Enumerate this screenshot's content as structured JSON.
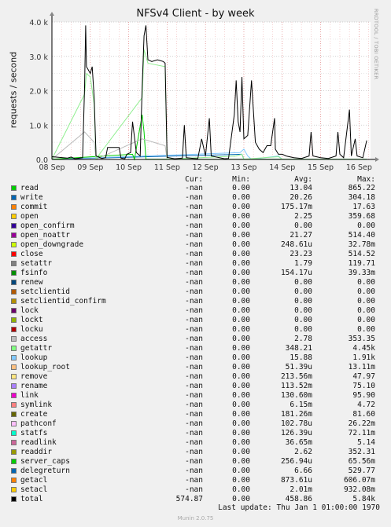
{
  "chart_data": {
    "type": "line",
    "title": "NFSv4 Client - by week",
    "ylabel": "requests / second",
    "xlabel": "",
    "ylim": [
      0,
      4000
    ],
    "y_ticks": [
      "0.0",
      "1.0 k",
      "2.0 k",
      "3.0 k",
      "4.0 k"
    ],
    "x_ticks": [
      "08 Sep",
      "09 Sep",
      "10 Sep",
      "11 Sep",
      "12 Sep",
      "13 Sep",
      "14 Sep",
      "15 Sep",
      "16 Sep"
    ],
    "x_range_days": [
      0,
      8.3
    ],
    "grid": true,
    "series": [
      {
        "name": "total",
        "color": "#000000",
        "points": [
          [
            0,
            80
          ],
          [
            0.2,
            60
          ],
          [
            0.4,
            40
          ],
          [
            0.5,
            70
          ],
          [
            0.6,
            20
          ],
          [
            0.8,
            50
          ],
          [
            0.85,
            2100
          ],
          [
            0.88,
            3900
          ],
          [
            0.9,
            2700
          ],
          [
            0.95,
            2600
          ],
          [
            1.0,
            2500
          ],
          [
            1.05,
            2700
          ],
          [
            1.1,
            1800
          ],
          [
            1.15,
            100
          ],
          [
            1.3,
            30
          ],
          [
            1.4,
            50
          ],
          [
            1.45,
            350
          ],
          [
            1.75,
            350
          ],
          [
            1.8,
            40
          ],
          [
            1.9,
            20
          ],
          [
            1.95,
            150
          ],
          [
            2.05,
            200
          ],
          [
            2.1,
            1100
          ],
          [
            2.2,
            200
          ],
          [
            2.3,
            100
          ],
          [
            2.35,
            2100
          ],
          [
            2.4,
            3600
          ],
          [
            2.45,
            3900
          ],
          [
            2.5,
            2900
          ],
          [
            2.6,
            2850
          ],
          [
            2.75,
            2900
          ],
          [
            2.9,
            2850
          ],
          [
            2.95,
            2800
          ],
          [
            3.0,
            60
          ],
          [
            3.2,
            20
          ],
          [
            3.4,
            40
          ],
          [
            3.45,
            1000
          ],
          [
            3.5,
            50
          ],
          [
            3.7,
            30
          ],
          [
            3.8,
            20
          ],
          [
            3.9,
            600
          ],
          [
            4.0,
            100
          ],
          [
            4.1,
            1200
          ],
          [
            4.15,
            100
          ],
          [
            4.5,
            20
          ],
          [
            4.6,
            30
          ],
          [
            4.75,
            1300
          ],
          [
            4.8,
            2300
          ],
          [
            4.85,
            1100
          ],
          [
            4.9,
            800
          ],
          [
            4.95,
            2400
          ],
          [
            5.0,
            600
          ],
          [
            5.1,
            700
          ],
          [
            5.2,
            2300
          ],
          [
            5.3,
            500
          ],
          [
            5.4,
            300
          ],
          [
            5.5,
            200
          ],
          [
            5.6,
            400
          ],
          [
            5.7,
            400
          ],
          [
            5.8,
            1200
          ],
          [
            5.82,
            300
          ],
          [
            5.9,
            150
          ],
          [
            6.0,
            150
          ],
          [
            6.1,
            100
          ],
          [
            6.3,
            50
          ],
          [
            6.5,
            30
          ],
          [
            6.7,
            100
          ],
          [
            6.75,
            800
          ],
          [
            6.8,
            100
          ],
          [
            7.0,
            50
          ],
          [
            7.2,
            30
          ],
          [
            7.4,
            100
          ],
          [
            7.45,
            800
          ],
          [
            7.5,
            150
          ],
          [
            7.6,
            50
          ],
          [
            7.75,
            1450
          ],
          [
            7.8,
            100
          ],
          [
            7.9,
            600
          ],
          [
            7.95,
            100
          ],
          [
            8.1,
            50
          ],
          [
            8.2,
            550
          ]
        ]
      },
      {
        "name": "getattr",
        "color": "#90ee90",
        "points": [
          [
            0,
            10
          ],
          [
            0.85,
            1900
          ],
          [
            0.9,
            2500
          ],
          [
            1.0,
            2400
          ],
          [
            1.1,
            1600
          ],
          [
            1.15,
            20
          ],
          [
            2.35,
            1800
          ],
          [
            2.4,
            3200
          ],
          [
            2.5,
            2800
          ],
          [
            2.95,
            2700
          ],
          [
            3.0,
            10
          ],
          [
            4.8,
            100
          ],
          [
            4.95,
            150
          ],
          [
            5.0,
            10
          ],
          [
            5.9,
            80
          ],
          [
            6.0,
            10
          ],
          [
            8.2,
            10
          ]
        ]
      },
      {
        "name": "access",
        "color": "#bbbbbb",
        "points": [
          [
            0,
            5
          ],
          [
            0.85,
            800
          ],
          [
            1.1,
            500
          ],
          [
            1.15,
            5
          ],
          [
            2.35,
            600
          ],
          [
            2.95,
            400
          ],
          [
            3.0,
            5
          ],
          [
            8.2,
            5
          ]
        ]
      },
      {
        "name": "read",
        "color": "#00cc00",
        "points": [
          [
            0,
            5
          ],
          [
            2.1,
            150
          ],
          [
            2.15,
            5
          ],
          [
            2.35,
            1300
          ],
          [
            2.4,
            800
          ],
          [
            2.45,
            5
          ],
          [
            8.2,
            5
          ]
        ]
      },
      {
        "name": "lookup",
        "color": "#80c8ff",
        "points": [
          [
            0,
            5
          ],
          [
            4.9,
            200
          ],
          [
            5.0,
            300
          ],
          [
            5.1,
            100
          ],
          [
            5.2,
            5
          ],
          [
            5.9,
            100
          ],
          [
            6.0,
            5
          ],
          [
            8.2,
            5
          ]
        ]
      },
      {
        "name": "write",
        "color": "#0066b3",
        "points": [
          [
            0,
            5
          ],
          [
            4.95,
            150
          ],
          [
            5.0,
            5
          ],
          [
            8.2,
            5
          ]
        ]
      }
    ]
  },
  "legend": {
    "headers": {
      "cur": "Cur:",
      "min": "Min:",
      "avg": "Avg:",
      "max": "Max:"
    },
    "rows": [
      {
        "name": "read",
        "color": "#00cc00",
        "cur": "-nan",
        "min": "0.00",
        "avg": "13.04",
        "max": "865.22"
      },
      {
        "name": "write",
        "color": "#0066b3",
        "cur": "-nan",
        "min": "0.00",
        "avg": "20.26",
        "max": "304.18"
      },
      {
        "name": "commit",
        "color": "#ff8000",
        "cur": "-nan",
        "min": "0.00",
        "avg": "175.17m",
        "max": "17.63"
      },
      {
        "name": "open",
        "color": "#ffcc00",
        "cur": "-nan",
        "min": "0.00",
        "avg": "2.25",
        "max": "359.68"
      },
      {
        "name": "open_confirm",
        "color": "#330099",
        "cur": "-nan",
        "min": "0.00",
        "avg": "0.00",
        "max": "0.00"
      },
      {
        "name": "open_noattr",
        "color": "#990099",
        "cur": "-nan",
        "min": "0.00",
        "avg": "21.27",
        "max": "514.40"
      },
      {
        "name": "open_downgrade",
        "color": "#ccff00",
        "cur": "-nan",
        "min": "0.00",
        "avg": "248.61u",
        "max": "32.78m"
      },
      {
        "name": "close",
        "color": "#ff0000",
        "cur": "-nan",
        "min": "0.00",
        "avg": "23.23",
        "max": "514.52"
      },
      {
        "name": "setattr",
        "color": "#808080",
        "cur": "-nan",
        "min": "0.00",
        "avg": "1.79",
        "max": "119.71"
      },
      {
        "name": "fsinfo",
        "color": "#008f00",
        "cur": "-nan",
        "min": "0.00",
        "avg": "154.17u",
        "max": "39.33m"
      },
      {
        "name": "renew",
        "color": "#00487d",
        "cur": "-nan",
        "min": "0.00",
        "avg": "0.00",
        "max": "0.00"
      },
      {
        "name": "setclientid",
        "color": "#b35a00",
        "cur": "-nan",
        "min": "0.00",
        "avg": "0.00",
        "max": "0.00"
      },
      {
        "name": "setclientid_confirm",
        "color": "#b38f00",
        "cur": "-nan",
        "min": "0.00",
        "avg": "0.00",
        "max": "0.00"
      },
      {
        "name": "lock",
        "color": "#6b006b",
        "cur": "-nan",
        "min": "0.00",
        "avg": "0.00",
        "max": "0.00"
      },
      {
        "name": "lockt",
        "color": "#8fb300",
        "cur": "-nan",
        "min": "0.00",
        "avg": "0.00",
        "max": "0.00"
      },
      {
        "name": "locku",
        "color": "#b30000",
        "cur": "-nan",
        "min": "0.00",
        "avg": "0.00",
        "max": "0.00"
      },
      {
        "name": "access",
        "color": "#bebebe",
        "cur": "-nan",
        "min": "0.00",
        "avg": "2.78",
        "max": "353.35"
      },
      {
        "name": "getattr",
        "color": "#80ff80",
        "cur": "-nan",
        "min": "0.00",
        "avg": "348.21",
        "max": "4.45k"
      },
      {
        "name": "lookup",
        "color": "#80c9ff",
        "cur": "-nan",
        "min": "0.00",
        "avg": "15.88",
        "max": "1.91k"
      },
      {
        "name": "lookup_root",
        "color": "#ffc080",
        "cur": "-nan",
        "min": "0.00",
        "avg": "51.39u",
        "max": "13.11m"
      },
      {
        "name": "remove",
        "color": "#ffe680",
        "cur": "-nan",
        "min": "0.00",
        "avg": "213.56m",
        "max": "47.97"
      },
      {
        "name": "rename",
        "color": "#aa80ff",
        "cur": "-nan",
        "min": "0.00",
        "avg": "113.52m",
        "max": "75.10"
      },
      {
        "name": "link",
        "color": "#ee00cc",
        "cur": "-nan",
        "min": "0.00",
        "avg": "130.60m",
        "max": "95.90"
      },
      {
        "name": "symlink",
        "color": "#ff8080",
        "cur": "-nan",
        "min": "0.00",
        "avg": "6.15m",
        "max": "4.72"
      },
      {
        "name": "create",
        "color": "#666600",
        "cur": "-nan",
        "min": "0.00",
        "avg": "181.26m",
        "max": "81.60"
      },
      {
        "name": "pathconf",
        "color": "#ffbfff",
        "cur": "-nan",
        "min": "0.00",
        "avg": "102.78u",
        "max": "26.22m"
      },
      {
        "name": "statfs",
        "color": "#00ffcc",
        "cur": "-nan",
        "min": "0.00",
        "avg": "126.39u",
        "max": "72.11m"
      },
      {
        "name": "readlink",
        "color": "#cc6699",
        "cur": "-nan",
        "min": "0.00",
        "avg": "36.65m",
        "max": "5.14"
      },
      {
        "name": "readdir",
        "color": "#999900",
        "cur": "-nan",
        "min": "0.00",
        "avg": "2.62",
        "max": "352.31"
      },
      {
        "name": "server_caps",
        "color": "#00cc00",
        "cur": "-nan",
        "min": "0.00",
        "avg": "256.94u",
        "max": "65.56m"
      },
      {
        "name": "delegreturn",
        "color": "#0066b3",
        "cur": "-nan",
        "min": "0.00",
        "avg": "6.66",
        "max": "529.77"
      },
      {
        "name": "getacl",
        "color": "#ff8000",
        "cur": "-nan",
        "min": "0.00",
        "avg": "873.61u",
        "max": "606.07m"
      },
      {
        "name": "setacl",
        "color": "#ffcc00",
        "cur": "-nan",
        "min": "0.00",
        "avg": "2.01m",
        "max": "932.08m"
      },
      {
        "name": "total",
        "color": "#000000",
        "cur": "574.87",
        "min": "0.00",
        "avg": "458.86",
        "max": "5.84k"
      }
    ]
  },
  "last_update": "Last update: Thu Jan  1 01:00:00 1970",
  "side_text": "RRDTOOL / TOBI OETIKER",
  "version": "Munin 2.0.75"
}
